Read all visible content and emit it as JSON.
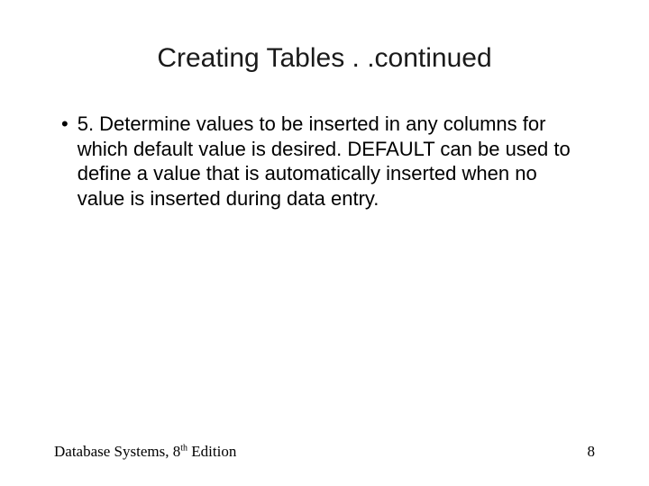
{
  "title": "Creating Tables . .continued",
  "bullet": "•",
  "body": "5. Determine values to be inserted in any columns for which default value is desired. DEFAULT  can be used to define a value that is automatically inserted when no value is inserted during data entry.",
  "footer": {
    "leftPrefix": "Database Systems, 8",
    "sup": "th",
    "leftSuffix": " Edition",
    "page": "8"
  }
}
